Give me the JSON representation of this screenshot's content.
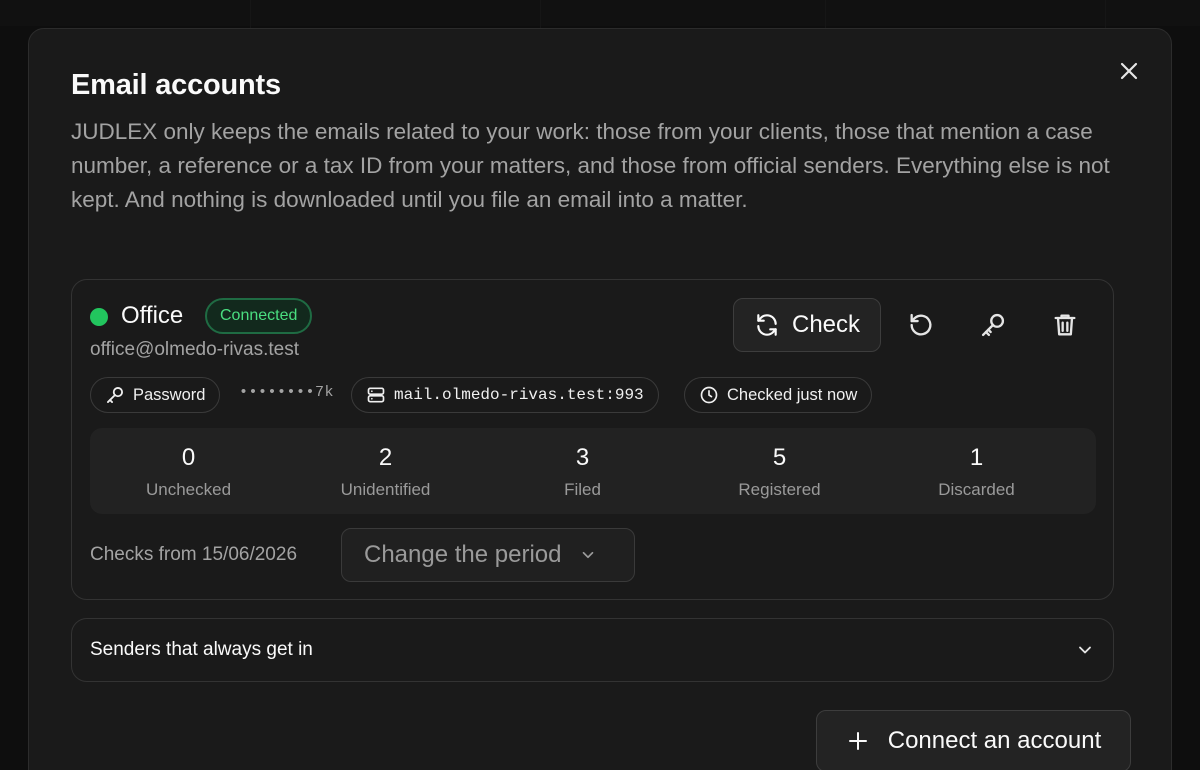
{
  "modal": {
    "title": "Email accounts",
    "description": "JUDLEX only keeps the emails related to your work: those from your clients, those that mention a case number, a reference or a tax ID from your matters, and those from official senders. Everything else is not kept. And nothing is downloaded until you file an email into a matter.",
    "close_icon": "close-icon"
  },
  "account": {
    "name": "Office",
    "status": "Connected",
    "status_color": "#22c55e",
    "email": "office@olmedo-rivas.test",
    "check_label": "Check",
    "actions": [
      "refresh-icon",
      "key-icon",
      "trash-icon"
    ],
    "auth_label": "Password",
    "masked_password": "••••••••7k",
    "server": "mail.olmedo-rivas.test:993",
    "last_checked": "Checked just now",
    "stats": [
      {
        "value": "0",
        "label": "Unchecked"
      },
      {
        "value": "2",
        "label": "Unidentified"
      },
      {
        "value": "3",
        "label": "Filed"
      },
      {
        "value": "5",
        "label": "Registered"
      },
      {
        "value": "1",
        "label": "Discarded"
      }
    ],
    "period_text": "Checks from 15/06/2026",
    "period_select": "Change the period"
  },
  "senders": {
    "label": "Senders that always get in"
  },
  "footer": {
    "connect_label": "Connect an account"
  }
}
